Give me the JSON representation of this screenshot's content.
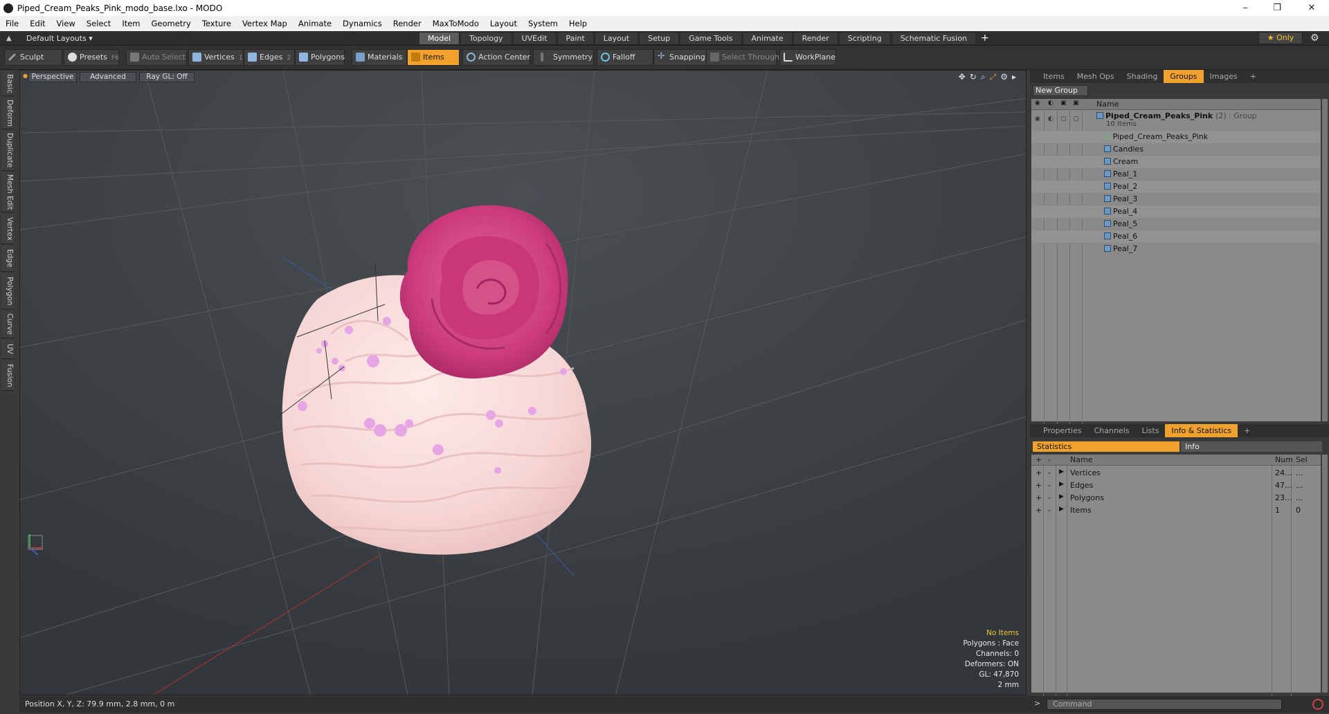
{
  "window": {
    "title": "Piped_Cream_Peaks_Pink_modo_base.lxo - MODO",
    "controls": [
      "–",
      "❐",
      "✕"
    ]
  },
  "menu": [
    "File",
    "Edit",
    "View",
    "Select",
    "Item",
    "Geometry",
    "Texture",
    "Vertex Map",
    "Animate",
    "Dynamics",
    "Render",
    "MaxToModo",
    "Layout",
    "System",
    "Help"
  ],
  "layout": {
    "selector": "Default Layouts ▾",
    "tabs": [
      "Model",
      "Topology",
      "UVEdit",
      "Paint",
      "Layout",
      "Setup",
      "Game Tools",
      "Animate",
      "Render",
      "Scripting",
      "Schematic Fusion"
    ],
    "active_tab": "Model",
    "only_label": "★  Only"
  },
  "toolbar": {
    "sculpt": "Sculpt",
    "presets": "Presets",
    "presets_key": "F6",
    "auto_select": "Auto Select",
    "vertices": "Vertices",
    "vertices_key": "1",
    "edges": "Edges",
    "edges_key": "2",
    "polygons": "Polygons",
    "materials": "Materials",
    "items": "Items",
    "action_center": "Action Center",
    "symmetry": "Symmetry",
    "falloff": "Falloff",
    "snapping": "Snapping",
    "select_through": "Select Through",
    "workplane": "WorkPlane"
  },
  "left_tabs": [
    "Basic",
    "Deform",
    "Duplicate",
    "Mesh Edit",
    "Vertex",
    "Edge",
    "Polygon",
    "Curve",
    "UV",
    "Fusion"
  ],
  "viewport": {
    "view": "Perspective",
    "shading": "Advanced",
    "raygl": "Ray GL: Off",
    "info": {
      "selection": "No Items",
      "polygons": "Polygons : Face",
      "channels": "Channels: 0",
      "deformers": "Deformers: ON",
      "gl": "GL: 47,870",
      "scale": "2 mm"
    }
  },
  "status": {
    "position": "Position X, Y, Z:   79.9 mm, 2.8 mm, 0 m"
  },
  "groups_panel": {
    "tabs": [
      "Items",
      "Mesh Ops",
      "Shading",
      "Groups",
      "Images"
    ],
    "active_tab": "Groups",
    "new_group": "New Group",
    "col_name": "Name",
    "group_name": "Piped_Cream_Peaks_Pink",
    "group_suffix": "(2) : Group",
    "group_count": "10 Items",
    "items": [
      "Piped_Cream_Peaks_Pink",
      "Candies",
      "Cream",
      "Peal_1",
      "Peal_2",
      "Peal_3",
      "Peal_4",
      "Peal_5",
      "Peal_6",
      "Peal_7"
    ]
  },
  "stats_panel": {
    "tabs": [
      "Properties",
      "Channels",
      "Lists",
      "Info & Statistics"
    ],
    "active_tab": "Info & Statistics",
    "sub_statistics": "Statistics",
    "sub_info": "Info",
    "col_name": "Name",
    "col_num": "Num",
    "col_sel": "Sel",
    "rows": [
      {
        "name": "Vertices",
        "num": "24...",
        "sel": "..."
      },
      {
        "name": "Edges",
        "num": "47...",
        "sel": "..."
      },
      {
        "name": "Polygons",
        "num": "23...",
        "sel": "..."
      },
      {
        "name": "Items",
        "num": "1",
        "sel": "0"
      }
    ]
  },
  "command": {
    "placeholder": "Command"
  },
  "colors": {
    "accent": "#f1a22c",
    "cream": "#f8dcdc",
    "rose": "#cf3e80",
    "pearl": "#e6a6e6"
  }
}
